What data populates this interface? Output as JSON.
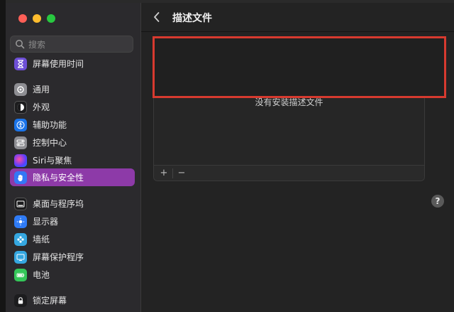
{
  "window": {
    "traffic_lights": {
      "close_color": "#fe5f57",
      "minimize_color": "#febc2e",
      "zoom_color": "#28c840"
    }
  },
  "search": {
    "placeholder": "搜索"
  },
  "sidebar": {
    "items": [
      {
        "label": "屏幕使用时间",
        "icon": "hourglass-icon",
        "color": "#6e4fd6"
      },
      {
        "label": "通用",
        "icon": "gear-icon",
        "color": "#8e8e93"
      },
      {
        "label": "外观",
        "icon": "appearance-icon",
        "color": "#1c1c1e"
      },
      {
        "label": "辅助功能",
        "icon": "accessibility-icon",
        "color": "#1a73e8"
      },
      {
        "label": "控制中心",
        "icon": "control-center-icon",
        "color": "#8e8e93"
      },
      {
        "label": "Siri与聚焦",
        "icon": "siri-icon",
        "color": "#3a3a8c"
      },
      {
        "label": "隐私与安全性",
        "icon": "hand-icon",
        "color": "#3478f6",
        "active": true
      },
      {
        "label": "桌面与程序坞",
        "icon": "dock-icon",
        "color": "#1c1c1e"
      },
      {
        "label": "显示器",
        "icon": "display-icon",
        "color": "#2f7bf6"
      },
      {
        "label": "墙纸",
        "icon": "wallpaper-icon",
        "color": "#35a7e0"
      },
      {
        "label": "屏幕保护程序",
        "icon": "screensaver-icon",
        "color": "#35a7e0"
      },
      {
        "label": "电池",
        "icon": "battery-icon",
        "color": "#34c759"
      },
      {
        "label": "锁定屏幕",
        "icon": "lock-icon",
        "color": "#1c1c1e"
      }
    ]
  },
  "main": {
    "title": "描述文件",
    "empty_message": "没有安装描述文件",
    "add_label": "+",
    "remove_label": "−",
    "help_label": "?"
  },
  "colors": {
    "accent_active": "#8d3aa8",
    "highlight_border": "#d73a2f"
  }
}
